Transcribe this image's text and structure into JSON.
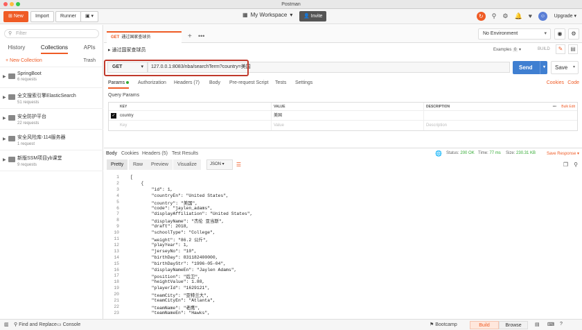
{
  "window": {
    "title": "Postman"
  },
  "toolbar": {
    "new_label": "New",
    "import_label": "Import",
    "runner_label": "Runner",
    "workspace_label": "My Workspace",
    "invite_label": "Invite",
    "upgrade_label": "Upgrade"
  },
  "sidebar": {
    "search_placeholder": "Filter",
    "tabs": [
      "History",
      "Collections",
      "APIs"
    ],
    "active_tab": "Collections",
    "new_collection_label": "+ New Collection",
    "trash_label": "Trash",
    "collections": [
      {
        "name": "SpringBoot",
        "requests": "6 requests"
      },
      {
        "name": "全文搜索引擎ElasticSearch",
        "requests": "51 requests"
      },
      {
        "name": "安全防护平台",
        "requests": "22 requests"
      },
      {
        "name": "安全风险库-114服务器",
        "requests": "1 request"
      },
      {
        "name": "新版SSM项目yb课堂",
        "requests": "9 requests"
      }
    ]
  },
  "request": {
    "tab_method": "GET",
    "tab_title": "通过国家查球员",
    "name": "通过国家查球员",
    "method": "GET",
    "url": "127.0.0.1:8083/nba/searchTerm?country=美国",
    "environment": "No Environment",
    "examples_label": "Examples",
    "examples_count": "0",
    "build_label": "BUILD",
    "send_label": "Send",
    "save_label": "Save"
  },
  "param_tabs": {
    "items": [
      "Params",
      "Authorization",
      "Headers (7)",
      "Body",
      "Pre-request Script",
      "Tests",
      "Settings"
    ],
    "cookies_label": "Cookies",
    "code_label": "Code",
    "query_params_label": "Query Params"
  },
  "params_table": {
    "headers": [
      "KEY",
      "VALUE",
      "DESCRIPTION"
    ],
    "bulk_edit_label": "Bulk Edit",
    "more_label": "•••",
    "rows": [
      {
        "key": "country",
        "value": "美国",
        "description": ""
      }
    ],
    "placeholder": {
      "key": "Key",
      "value": "Value",
      "description": "Description"
    }
  },
  "response": {
    "tabs": [
      "Body",
      "Cookies",
      "Headers (5)",
      "Test Results"
    ],
    "status_label": "Status:",
    "status_value": "200 OK",
    "time_label": "Time:",
    "time_value": "77 ms",
    "size_label": "Size:",
    "size_value": "230.31 KB",
    "save_response_label": "Save Response",
    "format_tabs": [
      "Pretty",
      "Raw",
      "Preview",
      "Visualize"
    ],
    "format_type": "JSON",
    "lines": [
      "[",
      "    {",
      "        \"id\": 1,",
      "        \"countryEn\": \"United States\",",
      "        \"country\": \"美国\",",
      "        \"code\": \"jaylen_adams\",",
      "        \"displayAffiliation\": \"United States\",",
      "        \"displayName\": \"杰伦 亚当斯\",",
      "        \"draft\": 2018,",
      "        \"schoolType\": \"College\",",
      "        \"weight\": \"86.2 公斤\",",
      "        \"playYear\": 1,",
      "        \"jerseyNo\": \"10\",",
      "        \"birthDay\": 831182400000,",
      "        \"birthDayStr\": \"1996-05-04\",",
      "        \"displayNameEn\": \"Jaylen Adams\",",
      "        \"position\": \"后卫\",",
      "        \"heightValue\": 1.88,",
      "        \"playerId\": \"1629121\",",
      "        \"teamCity\": \"亚特兰大\",",
      "        \"teamCityEn\": \"Atlanta\",",
      "        \"teamName\": \"老鹰\",",
      "        \"teamNameEn\": \"Hawks\","
    ]
  },
  "statusbar": {
    "find_replace_label": "Find and Replace",
    "console_label": "Console",
    "bootcamp_label": "Bootcamp",
    "build_label": "Build",
    "browse_label": "Browse"
  },
  "colors": {
    "accent": "#ef5b25",
    "send": "#3f7fd1",
    "highlight_box": "#c0392b"
  }
}
